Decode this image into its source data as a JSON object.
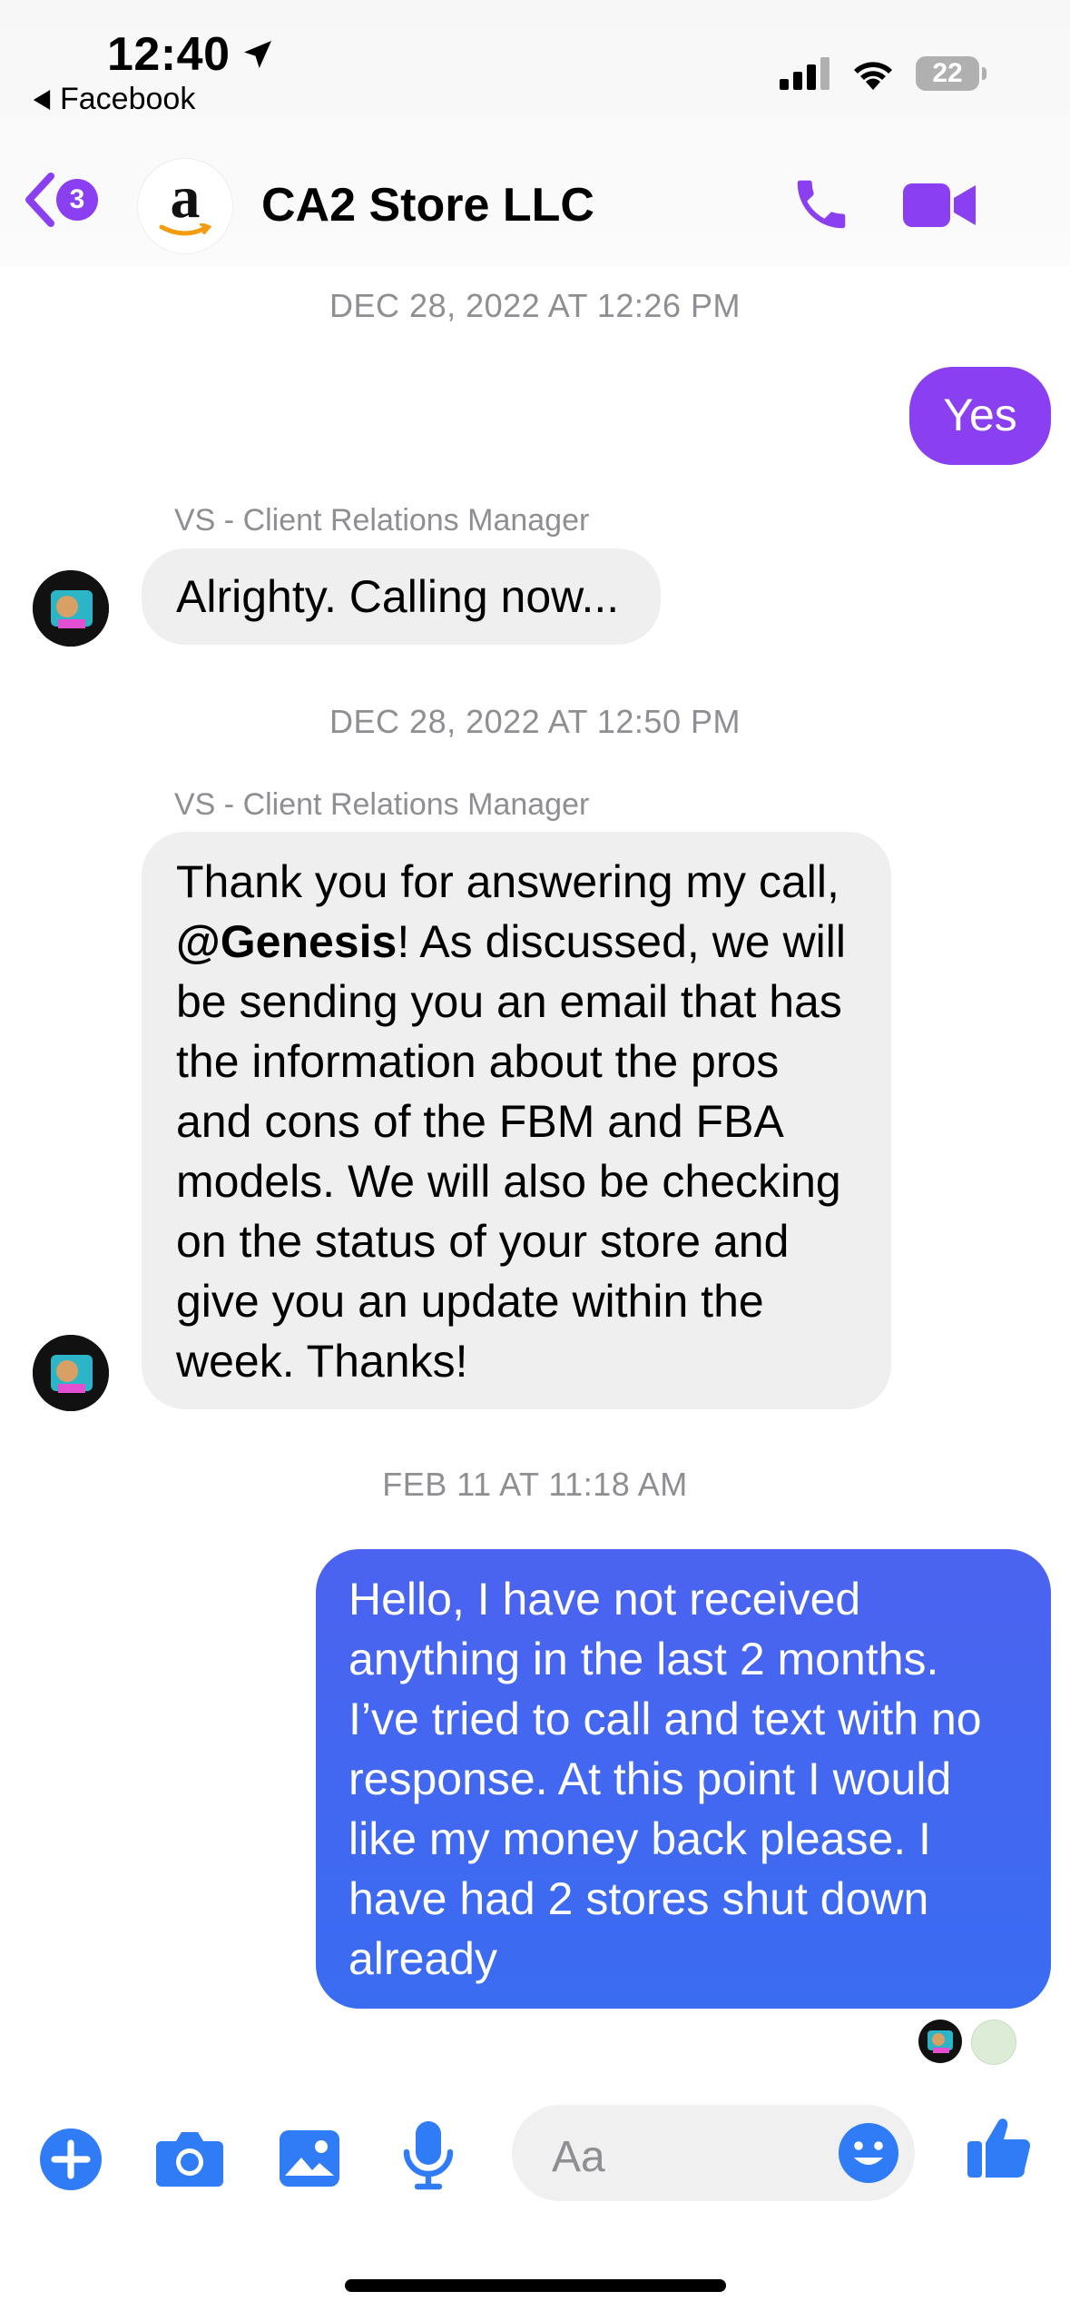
{
  "status_bar": {
    "time": "12:40",
    "back_app": "Facebook",
    "battery": "22"
  },
  "header": {
    "unread_count": "3",
    "contact_name": "CA2 Store LLC",
    "avatar_logo": "a",
    "icons": [
      "chevron-left-icon",
      "phone-icon",
      "video-camera-icon"
    ]
  },
  "conversation": {
    "timestamp_1": "DEC 28, 2022 AT 12:26 PM",
    "msg_yes": "Yes",
    "sender_1": "VS - Client Relations Manager",
    "msg_calling": "Alrighty. Calling now...",
    "timestamp_2": "DEC 28, 2022 AT 12:50 PM",
    "sender_2": "VS - Client Relations Manager",
    "msg_long_before": "Thank you for answering my call, ",
    "msg_long_mention": "@Genesis",
    "msg_long_after": "! As discussed, we will be sending you an email that has the information about the pros and cons of the FBM and FBA models. We will also be checking on the status of your store and give you an update within the week. Thanks!",
    "timestamp_3": "FEB 11 AT 11:18 AM",
    "msg_outgoing_long": "Hello, I have not received anything in the last 2 months. I’ve tried to call and text with no response. At this point I would like my money back please. I have had 2 stores shut down already"
  },
  "composer": {
    "placeholder": "Aa",
    "icons": [
      "plus-icon",
      "camera-icon",
      "image-icon",
      "microphone-icon",
      "emoji-icon",
      "thumbs-up-icon"
    ]
  },
  "colors": {
    "accent_purple": "#8a3ff0",
    "bubble_blue": "#4466f0",
    "composer_blue": "#2f7cf6"
  }
}
